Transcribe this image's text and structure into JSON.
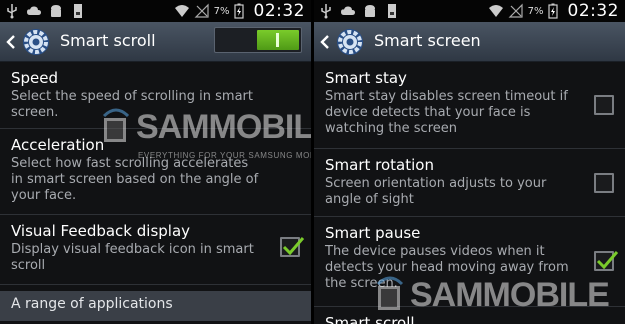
{
  "status_bar": {
    "battery_percent": "7%",
    "time": "02:32"
  },
  "left": {
    "title": "Smart scroll",
    "toggle_on": true,
    "items": [
      {
        "title": "Speed",
        "desc": "Select the speed of scrolling in smart screen."
      },
      {
        "title": "Acceleration",
        "desc": "Select how fast scrolling accelerates in smart screen based on the angle of your face."
      },
      {
        "title": "Visual Feedback display",
        "desc": "Display visual feedback icon in smart scroll",
        "checked": true
      }
    ],
    "section_header": "A range of applications"
  },
  "right": {
    "title": "Smart screen",
    "items": [
      {
        "title": "Smart stay",
        "desc": "Smart stay disables screen timeout if device detects that your face is watching the screen",
        "checked": false
      },
      {
        "title": "Smart rotation",
        "desc": "Screen orientation adjusts to your angle of sight",
        "checked": false
      },
      {
        "title": "Smart pause",
        "desc": "The device pauses videos when it detects your head moving away from the screen.",
        "checked": true
      },
      {
        "title": "Smart scroll",
        "desc": ""
      }
    ]
  },
  "watermark": {
    "logo_text": "SAMMOBILE",
    "tagline": "EVERYTHING FOR YOUR SAMSUNG MOBILE"
  },
  "colors": {
    "accent_green": "#7acb2b",
    "action_bar": "#3d4653",
    "section_header": "#3a3f47"
  }
}
